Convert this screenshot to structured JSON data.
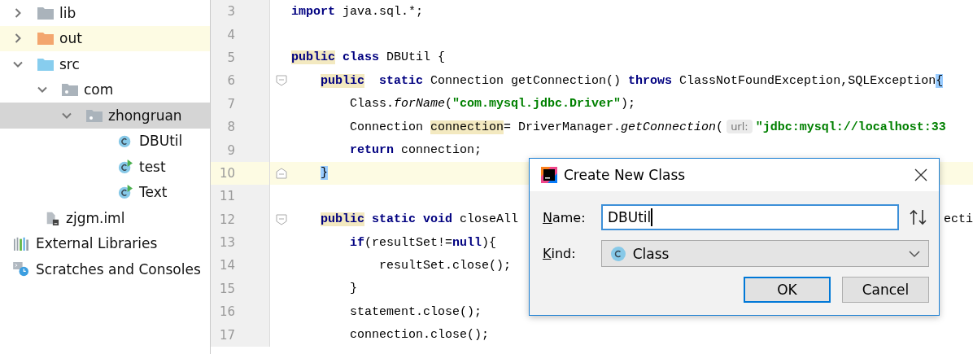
{
  "project_tree": {
    "items": [
      {
        "label": "lib",
        "kind": "folder",
        "expanded": false,
        "selected": false
      },
      {
        "label": "out",
        "kind": "excluded-folder",
        "expanded": false,
        "selected": false
      },
      {
        "label": "src",
        "kind": "source-folder",
        "expanded": true,
        "selected": false,
        "children": [
          {
            "label": "com",
            "kind": "package",
            "expanded": true,
            "selected": false,
            "children": [
              {
                "label": "zhongruan",
                "kind": "package",
                "expanded": true,
                "selected": true,
                "children": [
                  {
                    "label": "DBUtil",
                    "kind": "class",
                    "selected": false
                  },
                  {
                    "label": "test",
                    "kind": "runnable-class",
                    "selected": false
                  },
                  {
                    "label": "Text",
                    "kind": "runnable-class",
                    "selected": false
                  }
                ]
              }
            ]
          }
        ]
      },
      {
        "label": "zjgm.iml",
        "kind": "module-file",
        "selected": false
      }
    ],
    "extra_items": [
      {
        "label": "External Libraries",
        "kind": "libraries",
        "selected": false
      },
      {
        "label": "Scratches and Consoles",
        "kind": "scratches",
        "selected": false
      }
    ]
  },
  "editor": {
    "lines": [
      {
        "number": "3",
        "kind": "plain",
        "current": false,
        "tokens": [
          {
            "kind": "kw",
            "text": "import"
          },
          {
            "kind": "plain",
            "text": " java.sql.*;"
          }
        ]
      },
      {
        "number": "4",
        "kind": "plain",
        "current": false
      },
      {
        "number": "5",
        "kind": "plain",
        "current": false,
        "tokens": [
          {
            "kind": "kw-mark",
            "text": "public"
          },
          {
            "kind": "kw",
            "text": " class"
          },
          {
            "kind": "plain",
            "text": " DBUtil {"
          }
        ],
        "children": [
          {
            "number": "6",
            "kind": "fold-start",
            "current": false,
            "tokens": [
              {
                "kind": "kw-mark",
                "text": "public"
              },
              {
                "kind": "kw",
                "text": "  static"
              },
              {
                "kind": "plain",
                "text": " Connection getConnection() "
              },
              {
                "kind": "kw",
                "text": "throws"
              },
              {
                "kind": "plain",
                "text": " ClassNotFoundException,SQLException"
              },
              {
                "kind": "brace",
                "text": "{"
              }
            ],
            "children": [
              {
                "number": "7",
                "kind": "plain",
                "current": false,
                "tokens": [
                  {
                    "kind": "plain",
                    "text": "Class."
                  },
                  {
                    "kind": "italic",
                    "text": "forName"
                  },
                  {
                    "kind": "plain",
                    "text": "("
                  },
                  {
                    "kind": "str",
                    "text": "\"com.mysql.jdbc.Driver\""
                  },
                  {
                    "kind": "plain",
                    "text": ");"
                  }
                ]
              },
              {
                "number": "8",
                "kind": "plain",
                "current": false,
                "tokens": [
                  {
                    "kind": "plain",
                    "text": "Connection "
                  },
                  {
                    "kind": "mark",
                    "text": "connection"
                  },
                  {
                    "kind": "plain",
                    "text": "= DriverManager."
                  },
                  {
                    "kind": "italic",
                    "text": "getConnection"
                  },
                  {
                    "kind": "plain",
                    "text": "("
                  },
                  {
                    "kind": "hint",
                    "text": "url:"
                  },
                  {
                    "kind": "str",
                    "text": "\"jdbc:mysql://localhost:33"
                  }
                ]
              },
              {
                "number": "9",
                "kind": "plain",
                "current": false,
                "tokens": [
                  {
                    "kind": "kw",
                    "text": "return"
                  },
                  {
                    "kind": "plain",
                    "text": " connection;"
                  }
                ]
              }
            ]
          },
          {
            "number": "10",
            "kind": "fold-end",
            "current": true,
            "tokens": [
              {
                "kind": "brace",
                "text": "}"
              }
            ]
          },
          {
            "number": "11",
            "kind": "plain",
            "current": false
          },
          {
            "number": "12",
            "kind": "fold-start",
            "current": false,
            "tokens": [
              {
                "kind": "kw-mark",
                "text": "public"
              },
              {
                "kind": "kw",
                "text": " static void"
              },
              {
                "kind": "plain",
                "text": " closeAll"
              },
              {
                "kind": "tail",
                "text": "ecti"
              }
            ],
            "children": [
              {
                "number": "13",
                "kind": "plain",
                "current": false,
                "tokens": [
                  {
                    "kind": "kw",
                    "text": "if"
                  },
                  {
                    "kind": "plain",
                    "text": "(resultSet!="
                  },
                  {
                    "kind": "kw",
                    "text": "null"
                  },
                  {
                    "kind": "plain",
                    "text": "){"
                  }
                ],
                "children": [
                  {
                    "number": "14",
                    "kind": "plain",
                    "current": false,
                    "tokens": [
                      {
                        "kind": "plain",
                        "text": "resultSet.close();"
                      }
                    ]
                  }
                ]
              },
              {
                "number": "15",
                "kind": "plain",
                "current": false,
                "tokens": [
                  {
                    "kind": "plain",
                    "text": "}"
                  }
                ]
              },
              {
                "number": "16",
                "kind": "plain",
                "current": false,
                "tokens": [
                  {
                    "kind": "plain",
                    "text": "statement.close();"
                  }
                ]
              },
              {
                "number": "17",
                "kind": "plain",
                "current": false,
                "tokens": [
                  {
                    "kind": "plain",
                    "text": "connection.close();"
                  }
                ]
              }
            ]
          }
        ]
      }
    ]
  },
  "dialog": {
    "title": "Create New Class",
    "name_label": "Name:",
    "name_value": "DBUtil",
    "kind_label": "Kind:",
    "kind_value": "Class",
    "buttons": [
      {
        "label": "OK",
        "default": true
      },
      {
        "label": "Cancel",
        "default": false
      }
    ]
  }
}
